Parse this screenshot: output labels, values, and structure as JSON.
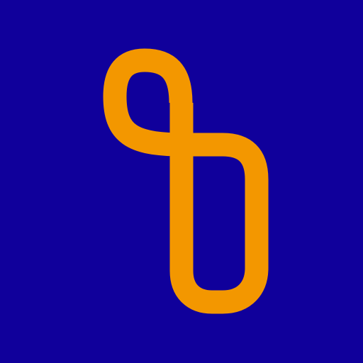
{
  "logo": {
    "icon": "looped-ribbon-logo-icon",
    "background_color": "#10009b",
    "stroke_color": "#f39700"
  }
}
